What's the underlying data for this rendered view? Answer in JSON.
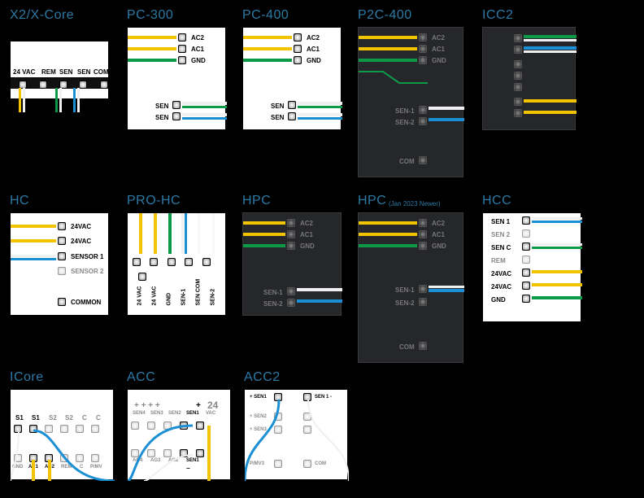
{
  "row1": {
    "x2": {
      "title": "X2/X-Core",
      "terms": [
        "24 VAC",
        "REM",
        "SEN",
        "SEN",
        "COM"
      ]
    },
    "pc300": {
      "title": "PC-300",
      "ac": [
        "AC2",
        "AC1",
        "GND"
      ],
      "sen": [
        "SEN",
        "SEN"
      ]
    },
    "pc400": {
      "title": "PC-400",
      "ac": [
        "AC2",
        "AC1",
        "GND"
      ],
      "sen": [
        "SEN",
        "SEN"
      ]
    },
    "p2c400": {
      "title": "P2C-400",
      "ac": [
        "AC2",
        "AC1",
        "GND"
      ],
      "sen": [
        "SEN-1",
        "SEN-2"
      ],
      "com": "COM"
    },
    "icc2": {
      "title": "ICC2"
    }
  },
  "row2": {
    "hc": {
      "title": "HC",
      "rows": [
        "24VAC",
        "24VAC",
        "SENSOR 1",
        "SENSOR 2",
        "COMMON"
      ]
    },
    "prohc": {
      "title": "PRO-HC",
      "cols": [
        "24 VAC",
        "24 VAC",
        "GND",
        "SEN-1",
        "SEN COM",
        "SEN-2"
      ]
    },
    "hpc": {
      "title": "HPC",
      "ac": [
        "AC2",
        "AC1",
        "GND"
      ],
      "sen": [
        "SEN-1",
        "SEN-2"
      ]
    },
    "hpc2": {
      "title": "HPC",
      "sub": "(Jan 2023 Newer)",
      "ac": [
        "AC2",
        "AC1",
        "GND"
      ],
      "sen": [
        "SEN-1",
        "SEN-2"
      ],
      "com": "COM"
    },
    "hcc": {
      "title": "HCC",
      "rows": [
        "SEN 1",
        "SEN 2",
        "SEN C",
        "REM",
        "24VAC",
        "24VAC",
        "GND"
      ]
    }
  },
  "row3": {
    "icore": {
      "title": "ICore",
      "top": [
        "S1",
        "S1",
        "S2",
        "S2",
        "C",
        "C"
      ],
      "bot": [
        "GND",
        "AC1",
        "AC2",
        "REM",
        "C",
        "P/MV"
      ]
    },
    "acc": {
      "title": "ACC",
      "top": [
        "SEN4",
        "SEN3",
        "SEN2",
        "SEN1",
        "24 VAC"
      ],
      "bot": [
        "AG4",
        "AG3",
        "AG2",
        "SEN1"
      ]
    },
    "acc2": {
      "title": "ACC2",
      "top": [
        "+ SEN1",
        "SEN 1 -"
      ],
      "left": [
        "+ SEN2",
        "+ SEN3"
      ],
      "bot": [
        "P/MV3",
        "COM"
      ]
    }
  }
}
